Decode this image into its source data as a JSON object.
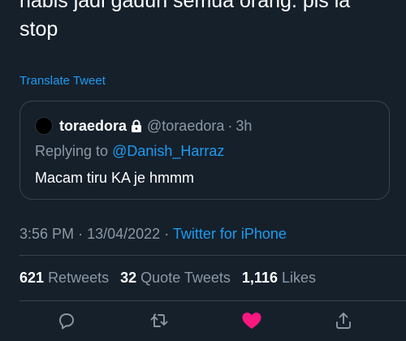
{
  "tweet": {
    "text": "habis jadi gaduh semua orang. pls la\nstop",
    "translate_label": "Translate Tweet"
  },
  "quote": {
    "name": "toraedora",
    "handle": "@toraedora",
    "separator": "·",
    "time": "3h",
    "replying_prefix": "Replying to ",
    "replying_to": "@Danish_Harraz",
    "text": "Macam tiru KA je hmmm"
  },
  "meta": {
    "time": "3:56 PM",
    "separator": "·",
    "date": "13/04/2022",
    "source": "Twitter for iPhone"
  },
  "stats": {
    "retweets_count": "621",
    "retweets_label": "Retweets",
    "quotes_count": "32",
    "quotes_label": "Quote Tweets",
    "likes_count": "1,116",
    "likes_label": "Likes"
  },
  "actions": [
    {
      "icon": "reply-icon"
    },
    {
      "icon": "retweet-icon"
    },
    {
      "icon": "like-icon",
      "color": "#f91880"
    },
    {
      "icon": "share-icon"
    }
  ],
  "colors": {
    "background": "#15202b",
    "accent": "#1d9bf0",
    "muted": "#8b98a5",
    "border": "#38444d",
    "like": "#f91880"
  }
}
